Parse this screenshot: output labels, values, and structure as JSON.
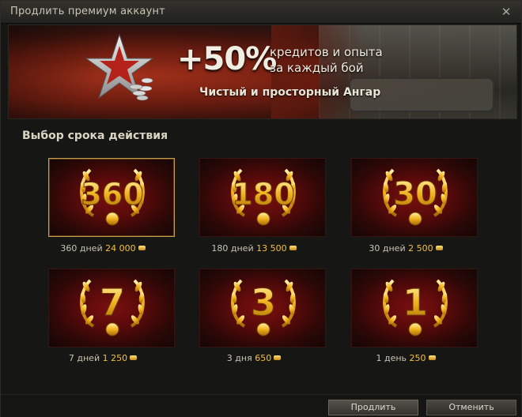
{
  "window": {
    "title": "Продлить премиум аккаунт",
    "close_glyph": "✕"
  },
  "banner": {
    "bonus": "+50%",
    "line1": "кредитов и опыта",
    "line2": "за каждый бой",
    "line3": "Чистый и просторный Ангар"
  },
  "section_title": "Выбор срока действия",
  "options": [
    {
      "badge": "360",
      "caption": "360 дней",
      "price": "24 000",
      "selected": true
    },
    {
      "badge": "180",
      "caption": "180 дней",
      "price": "13 500",
      "selected": false
    },
    {
      "badge": "30",
      "caption": "30 дней",
      "price": "2 500",
      "selected": false
    },
    {
      "badge": "7",
      "caption": "7 дней",
      "price": "1 250",
      "selected": false
    },
    {
      "badge": "3",
      "caption": "3 дня",
      "price": "650",
      "selected": false
    },
    {
      "badge": "1",
      "caption": "1 день",
      "price": "250",
      "selected": false
    }
  ],
  "buttons": {
    "confirm": "Продлить",
    "cancel": "Отменить"
  },
  "icons": {
    "gold": "gold-coin-icon",
    "banner_star": "red-star-icon",
    "close": "close-icon"
  },
  "colors": {
    "gold": "#f3c13a",
    "card_red": "#5a0a0a",
    "selected_border": "#c89b45"
  }
}
